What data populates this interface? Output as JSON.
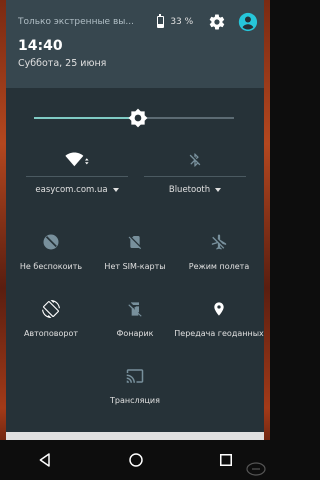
{
  "status": {
    "carrier": "Только экстренные вы...",
    "battery": "33 %",
    "time": "14:40",
    "date": "Суббота, 25 июня"
  },
  "brightness": {
    "level": 0.52
  },
  "toggles_top": [
    {
      "label": "easycom.com.ua",
      "icon": "wifi-icon"
    },
    {
      "label": "Bluetooth",
      "icon": "bluetooth-off-icon"
    }
  ],
  "tiles": [
    {
      "label": "Не беспокоить",
      "icon": "do-not-disturb-icon"
    },
    {
      "label": "Нет SIM-карты",
      "icon": "no-sim-icon"
    },
    {
      "label": "Режим полета",
      "icon": "airplane-icon"
    },
    {
      "label": "Автоповорот",
      "icon": "auto-rotate-icon"
    },
    {
      "label": "Фонарик",
      "icon": "flashlight-icon"
    },
    {
      "label": "Передача геоданных",
      "icon": "location-icon"
    },
    {
      "label": "Трансляция",
      "icon": "cast-icon"
    }
  ],
  "colors": {
    "panel": "#263238",
    "header": "#37474f",
    "accent": "#80cbc4",
    "avatar": "#26c6da"
  }
}
